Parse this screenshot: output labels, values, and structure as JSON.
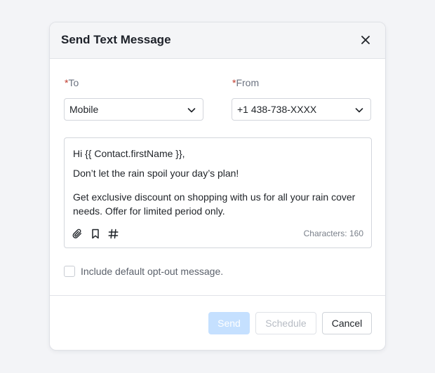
{
  "dialog": {
    "title": "Send Text Message",
    "close_icon": "close-icon"
  },
  "form": {
    "to": {
      "required_mark": "*",
      "label": "To",
      "selected": "Mobile",
      "icon": "chevron-down-icon"
    },
    "from": {
      "required_mark": "*",
      "label": "From",
      "selected": "+1 438-738-XXXX",
      "icon": "chevron-down-icon"
    }
  },
  "editor": {
    "greeting": "Hi {{ Contact.firstName }},",
    "line2": "Don’t let the rain spoil your day’s plan!",
    "line3": "Get exclusive discount on shopping with us for all your rain cover needs. Offer for limited period only.",
    "toolbar_icons": [
      "paperclip-icon",
      "bookmark-icon",
      "hash-icon"
    ],
    "char_count": "Characters: 160"
  },
  "optout": {
    "checked": false,
    "label": "Include default opt-out message."
  },
  "footer": {
    "send_label": "Send",
    "schedule_label": "Schedule",
    "cancel_label": "Cancel"
  },
  "colors": {
    "background": "#f3f4f7",
    "header_bg": "#f4f5f7",
    "required": "#c0392b",
    "send_disabled_bg": "#c5e0ff",
    "muted_text": "#6b7280"
  }
}
